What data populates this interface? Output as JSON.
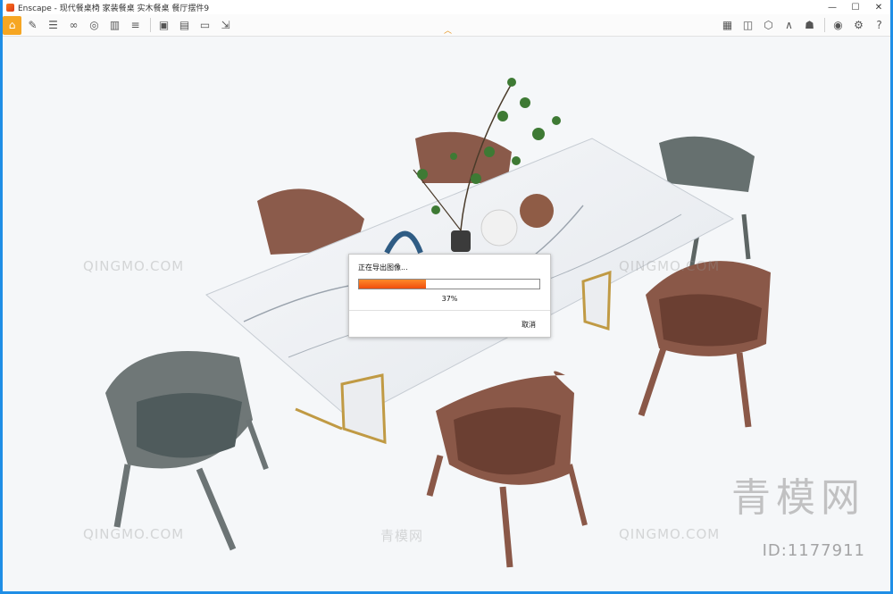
{
  "titlebar": {
    "title": "Enscape - 现代餐桌椅 家装餐桌 实木餐桌 餐厅摆件9"
  },
  "window_controls": [
    "—",
    "☐",
    "✕"
  ],
  "toolbar": {
    "left_icons": [
      "home-icon",
      "pen-icon",
      "bim-icon",
      "binoculars-icon",
      "map-icon",
      "city-icon",
      "bars-icon",
      "clipper-icon",
      "screenshot-icon",
      "batch-render-icon",
      "panorama-icon",
      "export-icon"
    ],
    "right_icons": [
      "asset-library-icon",
      "materials-icon",
      "cube-icon",
      "vr-icon",
      "hat-icon",
      "eye-icon",
      "gear-icon",
      "help-icon"
    ]
  },
  "export_dialog": {
    "title": "正在导出图像...",
    "progress": 0.37,
    "percent": "37%",
    "cancel_label": "取消"
  },
  "watermarks": {
    "site": "QINGMO.COM",
    "cn_site": "青模网",
    "brand": "青模网",
    "id": "ID:1177911"
  },
  "colors": {
    "accent": "#1f8ee6",
    "active_tool": "#f6a623",
    "progress": "#f2600f"
  }
}
